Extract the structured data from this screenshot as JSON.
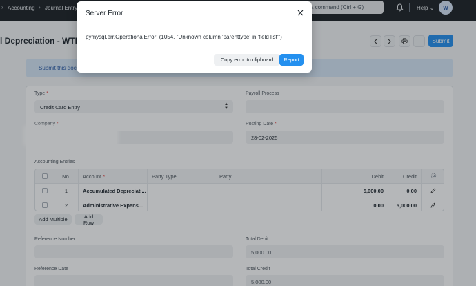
{
  "navbar": {
    "breadcrumbs": [
      "Accounting",
      "Journal Entry"
    ],
    "search_text": "a command (Ctrl + G)",
    "help_label": "Help",
    "avatar_initial": "W"
  },
  "page": {
    "title": "l Depreciation - WTP",
    "submit_label": "Submit",
    "banner_text": "Submit this docu"
  },
  "form": {
    "type_label": "Type",
    "type_value": "Credit Card Entry",
    "payroll_label": "Payroll Process",
    "company_label": "Company",
    "posting_date_label": "Posting Date",
    "posting_date_value": "28-02-2025",
    "accounting_entries_label": "Accounting Entries",
    "reference_number_label": "Reference Number",
    "reference_date_label": "Reference Date",
    "total_debit_label": "Total Debit",
    "total_debit_value": "5,000.00",
    "total_credit_label": "Total Credit",
    "total_credit_value": "5,000.00"
  },
  "table": {
    "headers": {
      "no": "No.",
      "account": "Account",
      "party_type": "Party Type",
      "party": "Party",
      "debit": "Debit",
      "credit": "Credit"
    },
    "rows": [
      {
        "no": "1",
        "account": "Accumulated Depreciati...",
        "party_type": "",
        "party": "",
        "debit": "5,000.00",
        "credit": "0.00"
      },
      {
        "no": "2",
        "account": "Administrative Expens...",
        "party_type": "",
        "party": "",
        "debit": "0.00",
        "credit": "5,000.00"
      }
    ],
    "add_multiple_label": "Add Multiple",
    "add_row_label": "Add Row"
  },
  "modal": {
    "title": "Server Error",
    "message": "pymysql.err.OperationalError: (1054, \"Unknown column 'parenttype' in 'field list'\")",
    "copy_label": "Copy error to clipboard",
    "report_label": "Report"
  },
  "colors": {
    "navbar": "#1c2126",
    "primary": "#2490ef",
    "banner": "#d6e6f7",
    "required": "#e24c4c"
  }
}
